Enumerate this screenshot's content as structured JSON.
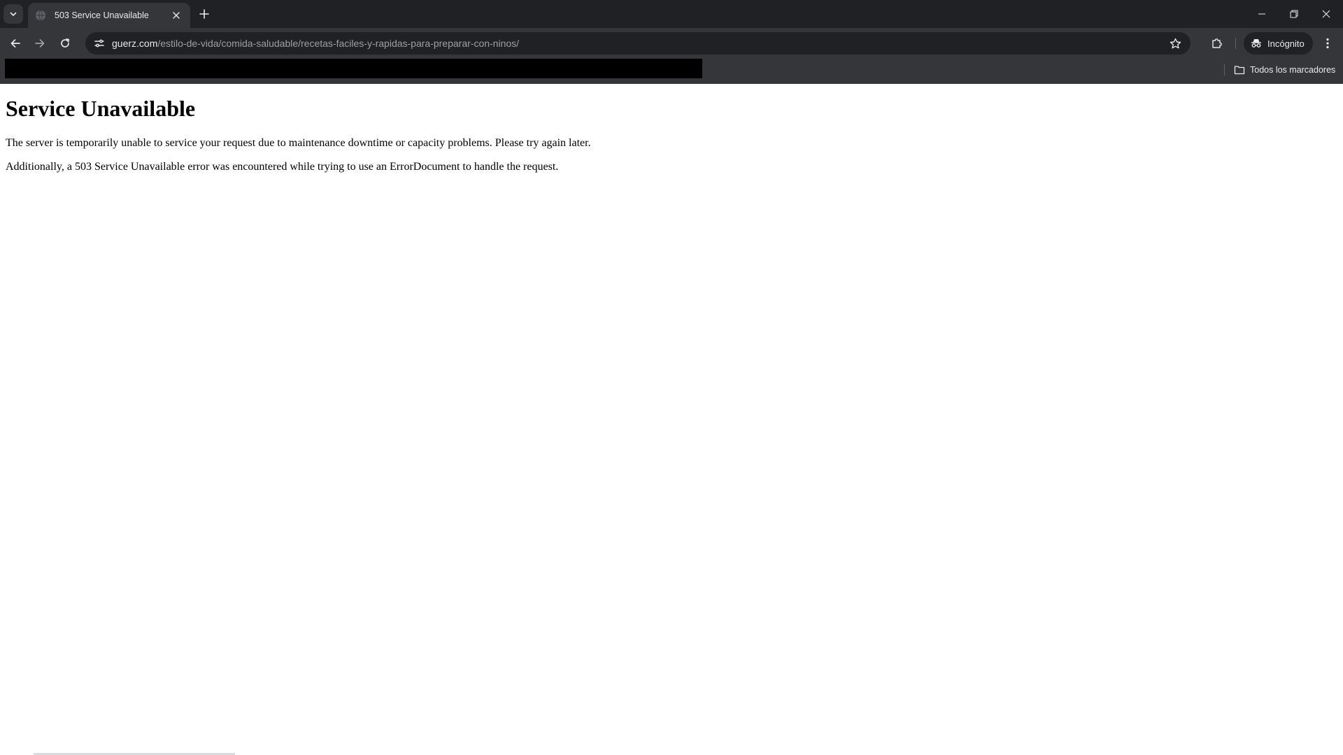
{
  "browser": {
    "tab": {
      "title": "503 Service Unavailable"
    },
    "address_bar": {
      "host": "guerz.com",
      "path": "/estilo-de-vida/comida-saludable/recetas-faciles-y-rapidas-para-preparar-con-ninos/"
    },
    "profile": {
      "label": "Incógnito"
    },
    "bookmarks_bar": {
      "all_bookmarks_label": "Todos los marcadores"
    },
    "colors": {
      "frame": "#202124",
      "toolbar": "#35363a",
      "text": "#e8eaed"
    }
  },
  "page": {
    "heading": "Service Unavailable",
    "paragraphs": [
      "The server is temporarily unable to service your request due to maintenance downtime or capacity problems. Please try again later.",
      "Additionally, a 503 Service Unavailable error was encountered while trying to use an ErrorDocument to handle the request."
    ]
  }
}
